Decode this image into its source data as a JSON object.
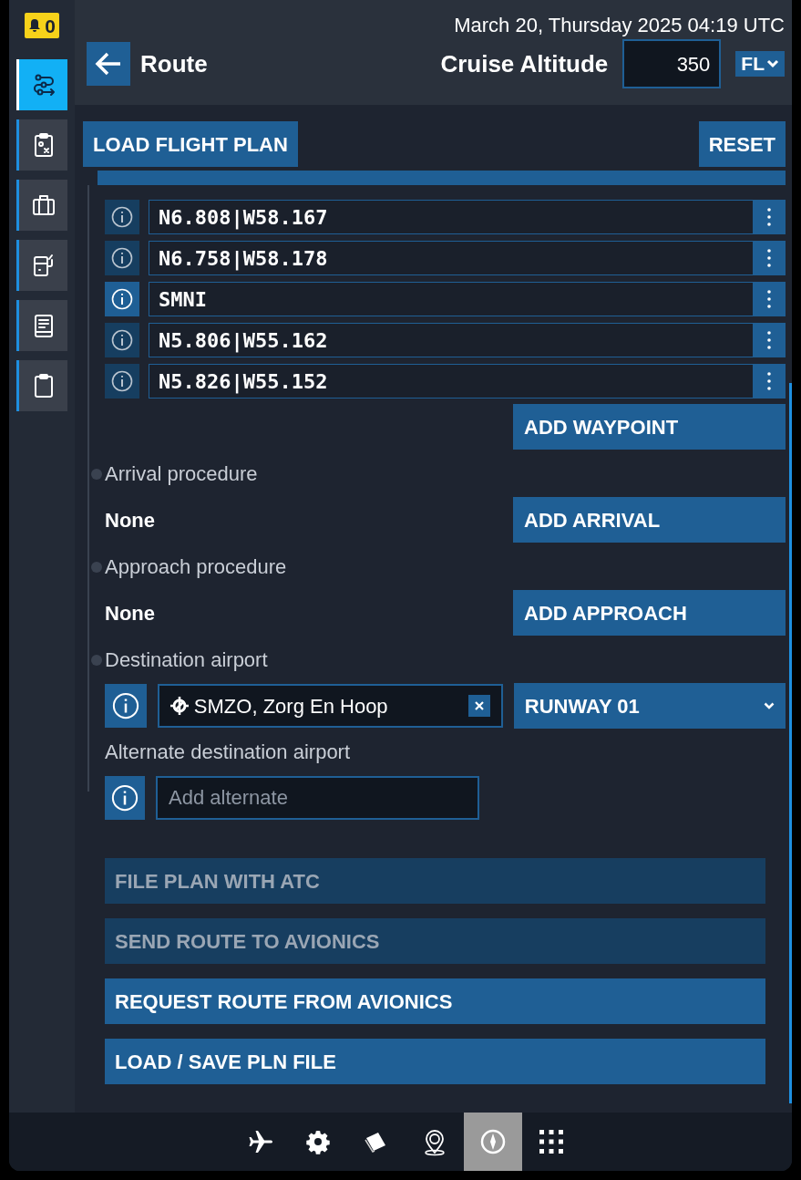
{
  "status_bar": {
    "alerts": "0",
    "datetime": "March 20, Thursday 2025 04:19 UTC"
  },
  "sidebar": {
    "items": [
      {
        "selected": true
      },
      {
        "selected": false
      },
      {
        "selected": false
      },
      {
        "selected": false
      },
      {
        "selected": false
      },
      {
        "selected": false
      }
    ]
  },
  "header": {
    "title": "Route",
    "cruise_altitude_label": "Cruise Altitude",
    "cruise_altitude": "350",
    "unit": "FL"
  },
  "toolbar": {
    "load": "LOAD FLIGHT PLAN",
    "reset": "RESET"
  },
  "waypoints": [
    {
      "name": "N6.808|W58.167",
      "selected": false
    },
    {
      "name": "N6.758|W58.178",
      "selected": false
    },
    {
      "name": "SMNI",
      "selected": true
    },
    {
      "name": "N5.806|W55.162",
      "selected": false
    },
    {
      "name": "N5.826|W55.152",
      "selected": false
    }
  ],
  "add_waypoint": "ADD WAYPOINT",
  "arrival": {
    "label": "Arrival procedure",
    "value": "None",
    "button": "ADD ARRIVAL"
  },
  "approach": {
    "label": "Approach procedure",
    "value": "None",
    "button": "ADD APPROACH"
  },
  "destination": {
    "label": "Destination airport",
    "value": "SMZO, Zorg En Hoop",
    "runway": "RUNWAY 01"
  },
  "alternate": {
    "label": "Alternate destination airport",
    "placeholder": "Add alternate"
  },
  "actions": [
    {
      "label": "FILE PLAN WITH ATC",
      "disabled": true
    },
    {
      "label": "SEND ROUTE TO AVIONICS",
      "disabled": true
    },
    {
      "label": "REQUEST ROUTE FROM AVIONICS",
      "disabled": false
    },
    {
      "label": "LOAD / SAVE PLN FILE",
      "disabled": false
    }
  ],
  "bottom_nav": [
    {
      "selected": false
    },
    {
      "selected": false
    },
    {
      "selected": false
    },
    {
      "selected": false
    },
    {
      "selected": true
    },
    {
      "selected": false
    }
  ]
}
